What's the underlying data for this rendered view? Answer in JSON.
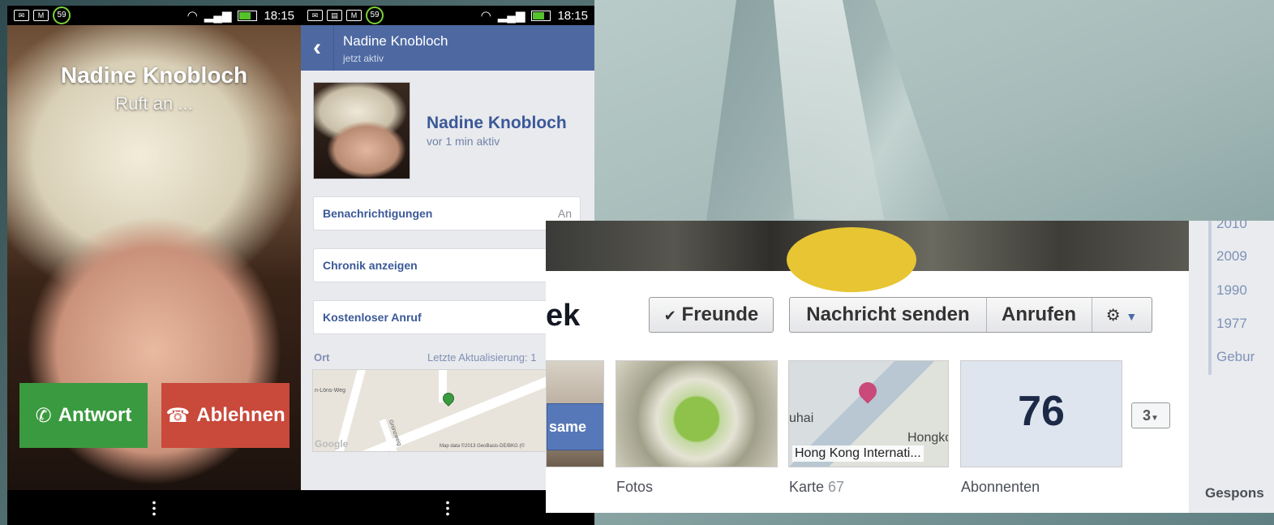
{
  "status_bar": {
    "time": "18:15",
    "battery_badge": "59"
  },
  "call_screen": {
    "caller_name": "Nadine Knobloch",
    "caller_status": "Ruft an ...",
    "answer_label": "Antwort",
    "decline_label": "Ablehnen"
  },
  "messenger": {
    "header_title": "Nadine Knobloch",
    "header_subtitle": "jetzt aktiv",
    "profile_name": "Nadine Knobloch",
    "profile_status": "vor 1 min aktiv",
    "rows": [
      {
        "label": "Benachrichtigungen",
        "value": "An"
      },
      {
        "label": "Chronik anzeigen",
        "value": ""
      },
      {
        "label": "Kostenloser Anruf",
        "value": ""
      }
    ],
    "location_label": "Ort",
    "location_update": "Letzte Aktualisierung: 1",
    "map_street_1": "n-Löns-Weg",
    "map_street_2": "Grünzweig",
    "map_credit": "Map data ©2013 GeoBasis-DE/BKG (©",
    "map_logo": "Google"
  },
  "fb_profile": {
    "name_fragment": "ek",
    "friends_button": "Freunde",
    "message_button": "Nachricht senden",
    "call_button": "Anrufen",
    "same_badge": "same",
    "map_label": "Hong Kong Internati...",
    "map_place_left": "uhai",
    "map_place_right": "Hongko",
    "subscribers_count": "76",
    "more_count": "3",
    "caption_photos": "Fotos",
    "caption_map": "Karte",
    "caption_map_count": "67",
    "caption_subscribers": "Abonnenten"
  },
  "timeline_years": [
    "2010",
    "2009",
    "1990",
    "1977",
    "Gebur"
  ],
  "sponsored_label": "Gespons"
}
